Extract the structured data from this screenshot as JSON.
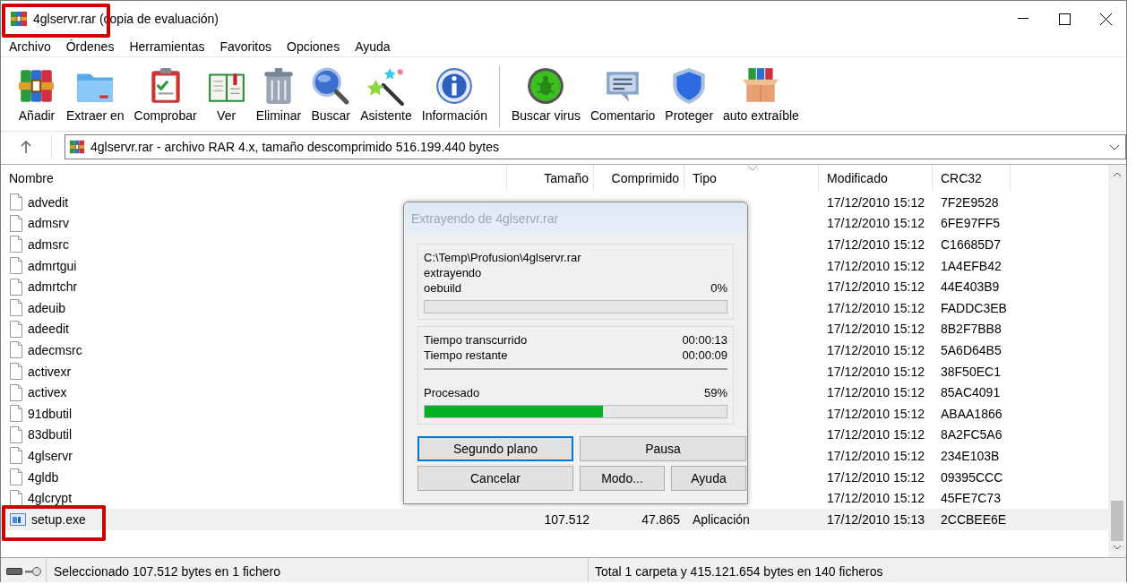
{
  "window": {
    "title": "4glservr.rar (copia de evaluación)",
    "highlighted": true
  },
  "menu": [
    "Archivo",
    "Órdenes",
    "Herramientas",
    "Favoritos",
    "Opciones",
    "Ayuda"
  ],
  "toolbar": [
    {
      "label": "Añadir"
    },
    {
      "label": "Extraer en"
    },
    {
      "label": "Comprobar"
    },
    {
      "label": "Ver"
    },
    {
      "label": "Eliminar"
    },
    {
      "label": "Buscar"
    },
    {
      "label": "Asistente"
    },
    {
      "label": "Información"
    },
    {
      "label": "Buscar virus"
    },
    {
      "label": "Comentario"
    },
    {
      "label": "Proteger"
    },
    {
      "label": "auto extraíble"
    }
  ],
  "address": "4glservr.rar - archivo RAR 4.x, tamaño descomprimido 516.199.440 bytes",
  "columns": [
    "Nombre",
    "Tamaño",
    "Comprimido",
    "Tipo",
    "Modificado",
    "CRC32"
  ],
  "files": [
    {
      "name": "advedit",
      "modified": "17/12/2010 15:12",
      "crc": "7F2E9528",
      "selected": false
    },
    {
      "name": "admsrv",
      "modified": "17/12/2010 15:12",
      "crc": "6FE97FF5",
      "selected": false
    },
    {
      "name": "admsrc",
      "modified": "17/12/2010 15:12",
      "crc": "C16685D7",
      "selected": false
    },
    {
      "name": "admrtgui",
      "modified": "17/12/2010 15:12",
      "crc": "1A4EFB42",
      "selected": false
    },
    {
      "name": "admrtchr",
      "modified": "17/12/2010 15:12",
      "crc": "44E403B9",
      "selected": false
    },
    {
      "name": "adeuib",
      "modified": "17/12/2010 15:12",
      "crc": "FADDC3EB",
      "selected": false
    },
    {
      "name": "adeedit",
      "modified": "17/12/2010 15:12",
      "crc": "8B2F7BB8",
      "selected": false
    },
    {
      "name": "adecmsrc",
      "modified": "17/12/2010 15:12",
      "crc": "5A6D64B5",
      "selected": false
    },
    {
      "name": "activexr",
      "modified": "17/12/2010 15:12",
      "crc": "38F50EC1",
      "selected": false
    },
    {
      "name": "activex",
      "modified": "17/12/2010 15:12",
      "crc": "85AC4091",
      "selected": false
    },
    {
      "name": "91dbutil",
      "modified": "17/12/2010 15:12",
      "crc": "ABAA1866",
      "selected": false
    },
    {
      "name": "83dbutil",
      "modified": "17/12/2010 15:12",
      "crc": "8A2FC5A6",
      "selected": false
    },
    {
      "name": "4glservr",
      "modified": "17/12/2010 15:12",
      "crc": "234E103B",
      "selected": false
    },
    {
      "name": "4gldb",
      "modified": "17/12/2010 15:12",
      "crc": "09395CCC",
      "selected": false
    },
    {
      "name": "4glcrypt",
      "modified": "17/12/2010 15:12",
      "crc": "45FE7C73",
      "selected": false
    },
    {
      "name": "setup.exe",
      "size": "107.512",
      "packed": "47.865",
      "type": "Aplicación",
      "modified": "17/12/2010 15:13",
      "crc": "2CCBEE6E",
      "selected": true,
      "highlighted": true,
      "kind": "exe"
    }
  ],
  "dialog": {
    "title": "Extrayendo de 4glservr.rar",
    "archive": "C:\\Temp\\Profusion\\4glservr.rar",
    "action": "extrayendo",
    "file": "oebuild",
    "file_progress": {
      "percent": "0%",
      "level": 0
    },
    "elapsed_label": "Tiempo transcurrido",
    "elapsed": "00:00:13",
    "remaining_label": "Tiempo restante",
    "remaining": "00:00:09",
    "processed_label": "Procesado",
    "processed_progress": {
      "percent": "59%",
      "level": 0.59
    },
    "buttons": [
      {
        "label": "Segundo plano",
        "focused": true
      },
      {
        "label": "Pausa",
        "focused": false
      },
      {
        "label": "Cancelar",
        "focused": false
      },
      {
        "label": "Modo...",
        "focused": false
      },
      {
        "label": "Ayuda",
        "focused": false
      }
    ]
  },
  "status": {
    "left": "Seleccionado 107.512 bytes en 1 fichero",
    "right": "Total 1 carpeta y 415.121.654 bytes en 140 ficheros"
  }
}
